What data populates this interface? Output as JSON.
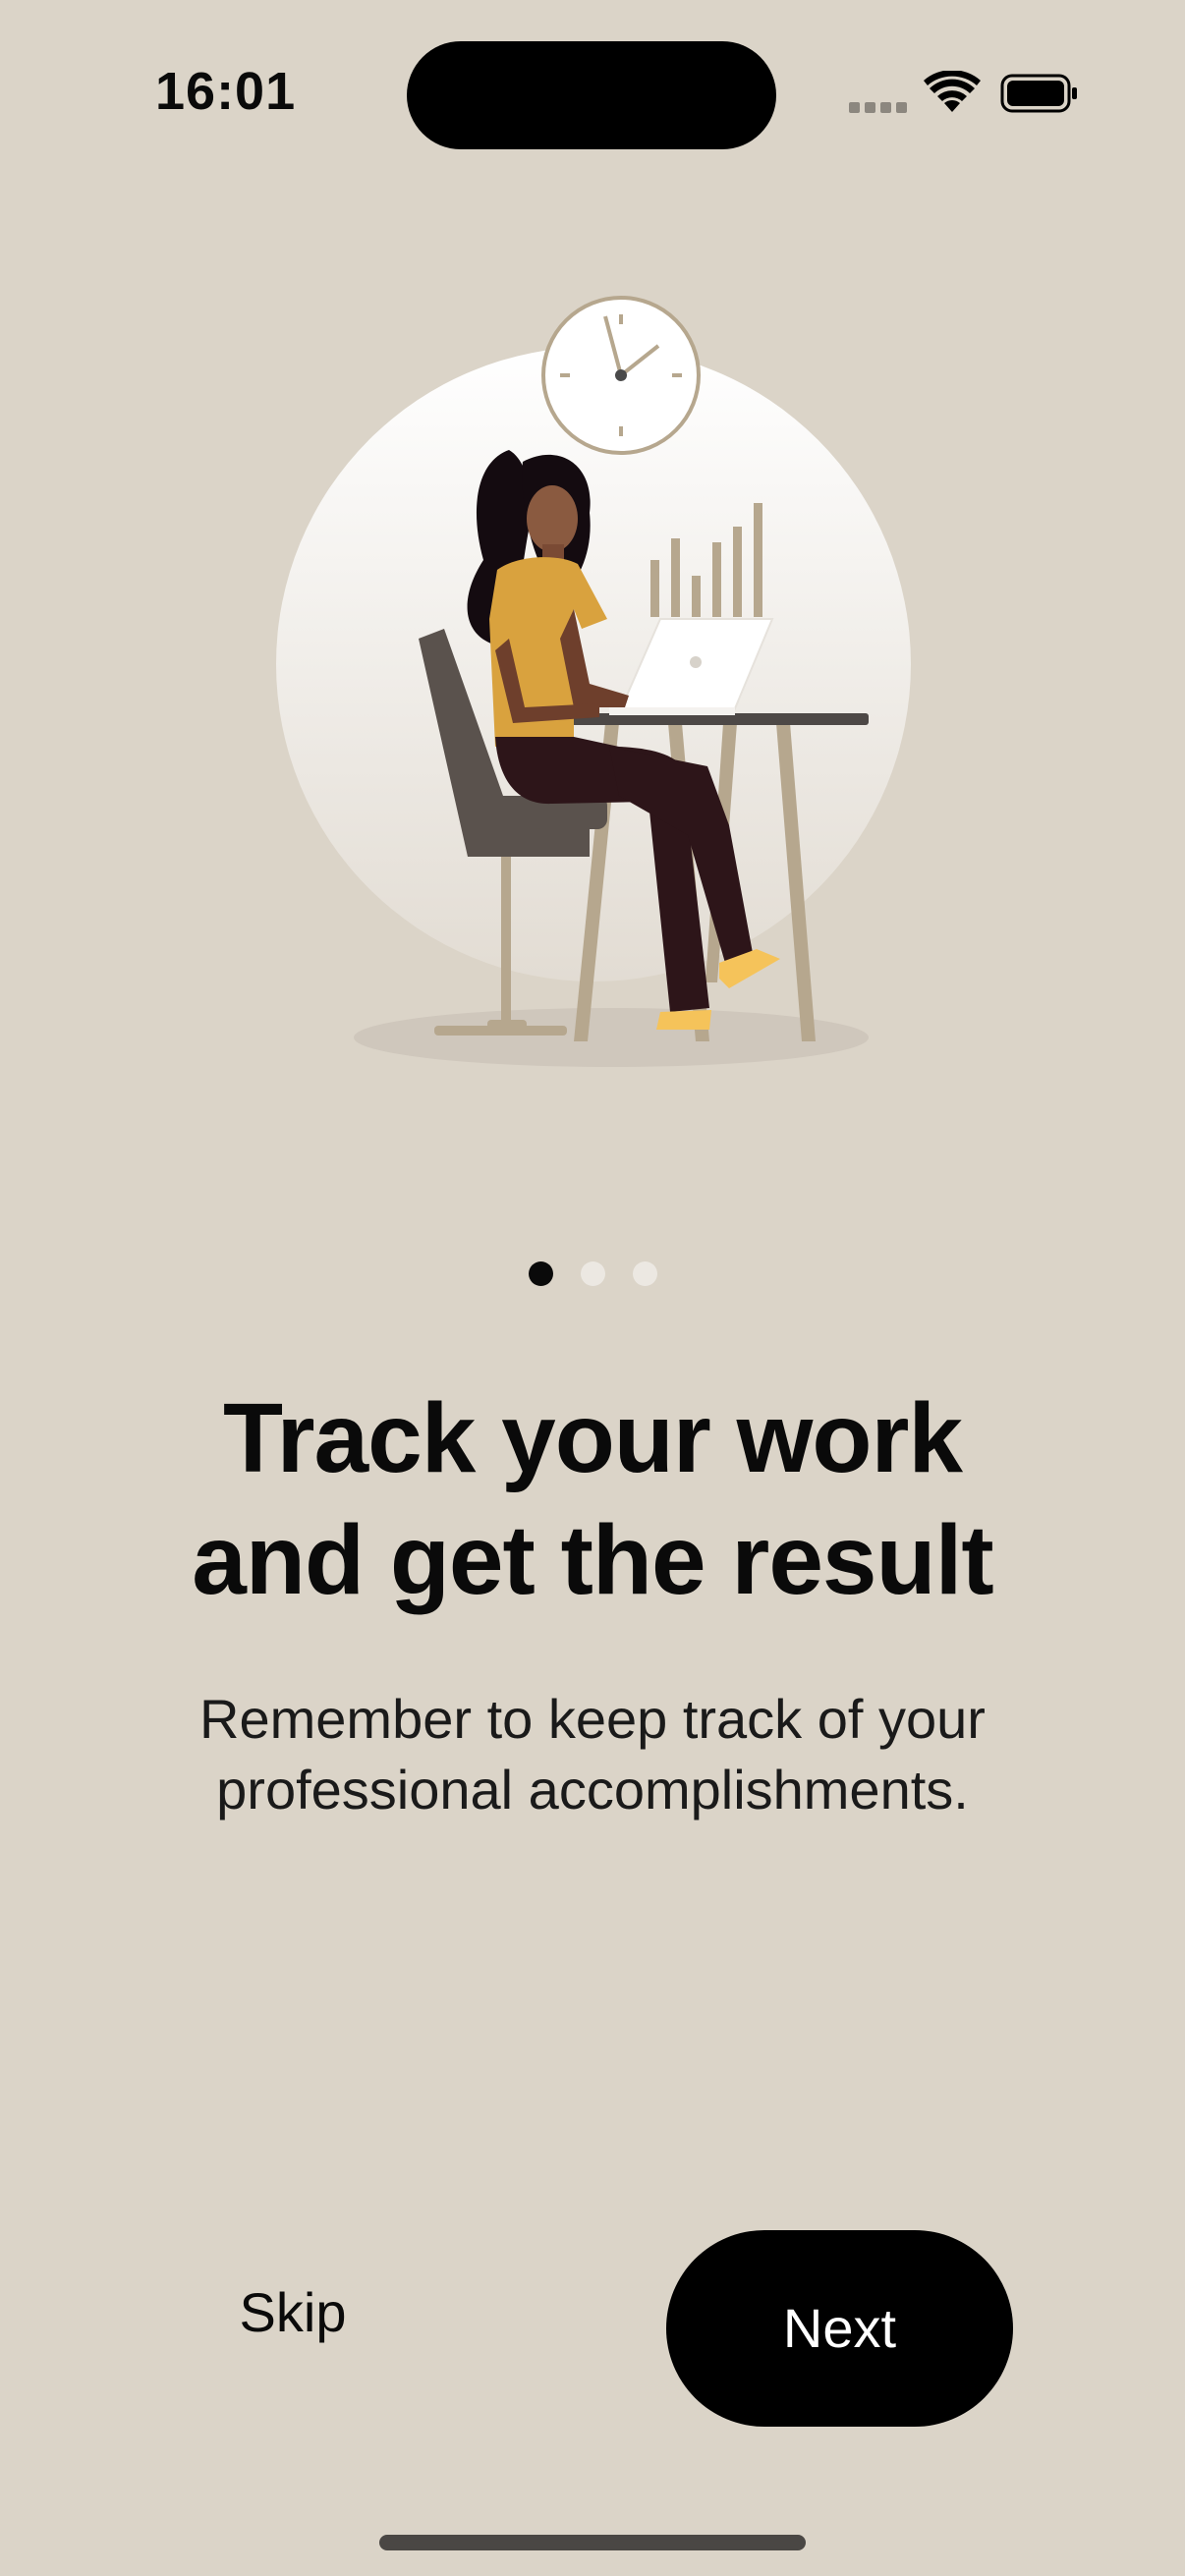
{
  "status_bar": {
    "time": "16:01",
    "icons": [
      "cellular-signal-icon",
      "wifi-icon",
      "battery-icon"
    ]
  },
  "illustration": {
    "icon": "woman-working-at-laptop-illustration",
    "clock_icon": "wall-clock-icon"
  },
  "pagination": {
    "total": 3,
    "current": 1
  },
  "onboarding": {
    "headline_line1": "Track your work",
    "headline_line2": "and get the result",
    "subtext_line1": "Remember to keep track of your",
    "subtext_line2": "professional accomplishments."
  },
  "actions": {
    "skip_label": "Skip",
    "next_label": "Next"
  },
  "colors": {
    "background": "#dbd4c8",
    "primary_button": "#000000",
    "accent_shirt": "#d9a23e",
    "accent_shoes": "#f5c35a"
  }
}
